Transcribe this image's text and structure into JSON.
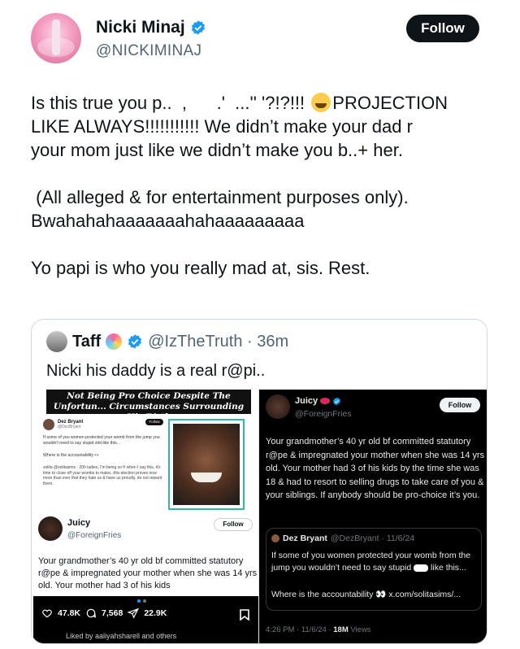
{
  "author": {
    "display_name": "Nicki Minaj",
    "handle": "@NICKIMINAJ",
    "follow_label": "Follow"
  },
  "tweet": {
    "line1": "Is this true you p..  ,      .'  ...'' '?!?!!! ",
    "line1b": "PROJECTION",
    "line2": "LIKE ALWAYS!!!!!!!!!!! We didn’t make your dad r",
    "line3": "your mom just like we didn’t make you b..+ her.",
    "line4": " (All alleged & for entertainment purposes only).",
    "line5": "Bwahahahaaaaaaahahaaaaaaaaa",
    "line6": "Yo papi is who you really mad at, sis. Rest."
  },
  "quote": {
    "name": "Taff",
    "handle_time": "@IzTheTruth · 36m",
    "text": "Nicki his daddy is a real r@pi..",
    "left_shot": {
      "banner": "Not Being Pro Choice Despite The Unfortun... Circumstances Surrounding His Birth",
      "mini_name": "Dez Bryant",
      "mini_handle": "@DezBryant",
      "mini_follow": "Follow",
      "mini_text": "If some of you women protected your womb from the jump you wouldn't need to say stupid shit like this...",
      "mini_text2": "Where is the accountability 👀",
      "mini_quote": "solita @solitasims · 20h  ladies, I'm being so fr when I say this, it's time to close off your wombs to males. this election proves now more than ever that they hate us & have us proudly. do not reward them.",
      "juicy_name": "Juicy",
      "juicy_handle": "@ForeignFries",
      "juicy_follow": "Follow",
      "juicy_text": "Your grandmother’s 40 yr old bf committed statutory r@pe & impregnated your mother when she was 14 yrs old. Your mother had 3 of his kids",
      "likes": "47.8K",
      "replies": "7,568",
      "views": "22.9K",
      "liked_by": "Liked by aaliyahsharell and others"
    },
    "right_shot": {
      "name": "Juicy",
      "handle": "@ForeignFries",
      "follow": "Follow",
      "text": "Your grandmother’s 40 yr old bf committed statutory r@pe & impregnated your mother when she was 14 yrs old. Your mother had 3 of his kids by the time she was 18 & had to resort to selling drugs to take care of you & your siblings. If anybody should be pro-choice it’s you.",
      "quote_name": "Dez Bryant",
      "quote_handle_time": "@DezBryant · 11/6/24",
      "quote_text_a": "If some of you women protected your womb from the jump you wouldn’t need to say stupid",
      "quote_text_b": "like this...",
      "quote_text2": "Where is the accountability 👀 x.com/solitasims/...",
      "meta_time": "4:26 PM · 11/6/24 · ",
      "meta_views": "18M",
      "meta_views_label": " Views"
    }
  },
  "colors": {
    "verified_blue": "#1d9bf0",
    "follow_bg": "#0f1419",
    "handle_gray": "#536471"
  }
}
